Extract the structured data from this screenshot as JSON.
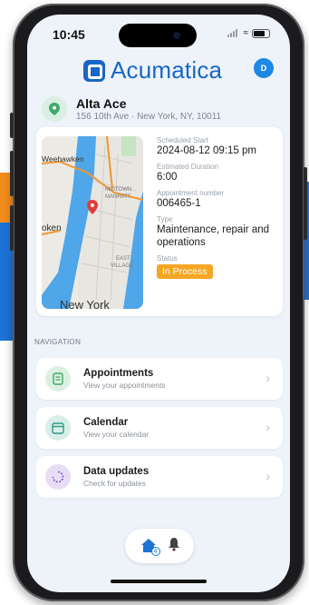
{
  "status_bar": {
    "time": "10:45"
  },
  "header": {
    "app_name": "Acumatica",
    "avatar_initial": "D",
    "brand_color": "#1866c7"
  },
  "location": {
    "name": "Alta Ace",
    "address": "156 10th Ave · New York, NY, 10011"
  },
  "appointment": {
    "map_labels": {
      "weehawken": "Weehawken",
      "midtown": "MIDTOWN",
      "manhattan": "MANHATT",
      "hoboken": "oken",
      "east": "EAST",
      "village": "VILLAGE",
      "new_york": "New York"
    },
    "fields": [
      {
        "label": "Scheduled Start",
        "value": "2024-08-12 09:15 pm"
      },
      {
        "label": "Estimated Duration",
        "value": "6:00"
      },
      {
        "label": "Appointment number",
        "value": "006465-1"
      },
      {
        "label": "Type",
        "value": "Maintenance, repair and operations"
      }
    ],
    "status_label": "Status",
    "status_value": "In Process",
    "status_color": "#f5a623"
  },
  "navigation": {
    "heading": "NAVIGATION",
    "items": [
      {
        "title": "Appointments",
        "subtitle": "View your appointments",
        "icon": "document-icon",
        "icon_bg": "#dbf0e2",
        "icon_color": "#3fa968"
      },
      {
        "title": "Calendar",
        "subtitle": "View your calendar",
        "icon": "calendar-icon",
        "icon_bg": "#d8efe8",
        "icon_color": "#2f9a86"
      },
      {
        "title": "Data updates",
        "subtitle": "Check for updates",
        "icon": "sync-icon",
        "icon_bg": "#e7def5",
        "icon_color": "#7b52c4"
      }
    ]
  },
  "tabbar": {
    "home_badge": "4"
  }
}
